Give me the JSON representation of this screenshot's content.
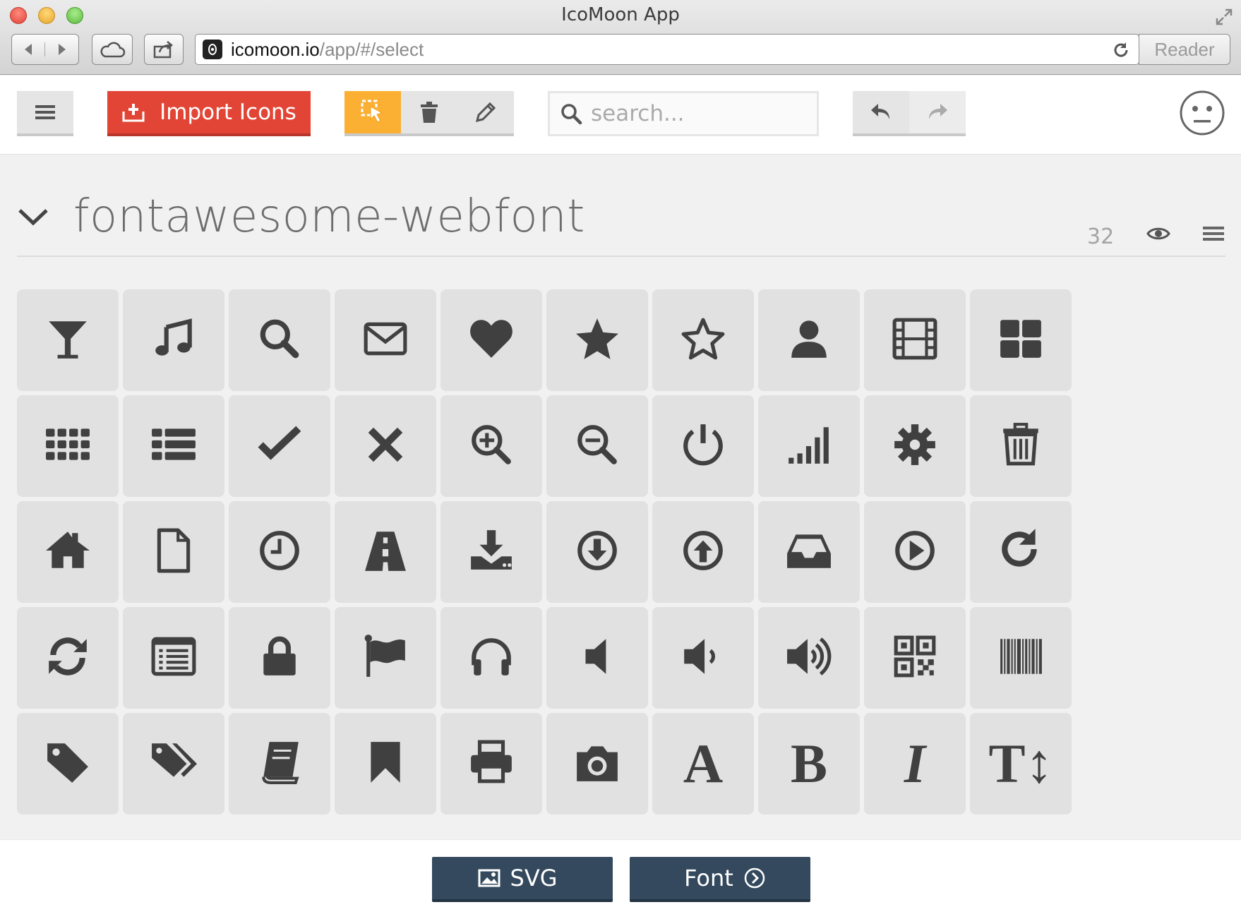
{
  "window": {
    "title": "IcoMoon App"
  },
  "address": {
    "host": "icomoon.io",
    "path": "/app/#/select",
    "reader_label": "Reader"
  },
  "toolbar": {
    "import_label": "Import Icons",
    "search_placeholder": "search..."
  },
  "icon_set": {
    "name": "fontawesome-webfont",
    "count": "32",
    "icons": [
      {
        "name": "glass-icon"
      },
      {
        "name": "music-icon"
      },
      {
        "name": "search-icon"
      },
      {
        "name": "envelope-icon"
      },
      {
        "name": "heart-icon"
      },
      {
        "name": "star-icon"
      },
      {
        "name": "star-empty-icon"
      },
      {
        "name": "user-icon"
      },
      {
        "name": "film-icon"
      },
      {
        "name": "th-large-icon"
      },
      {
        "name": "th-icon"
      },
      {
        "name": "th-list-icon"
      },
      {
        "name": "ok-icon"
      },
      {
        "name": "remove-icon"
      },
      {
        "name": "zoom-in-icon"
      },
      {
        "name": "zoom-out-icon"
      },
      {
        "name": "off-icon"
      },
      {
        "name": "signal-icon"
      },
      {
        "name": "cog-icon"
      },
      {
        "name": "trash-icon"
      },
      {
        "name": "home-icon"
      },
      {
        "name": "file-icon"
      },
      {
        "name": "time-icon"
      },
      {
        "name": "road-icon"
      },
      {
        "name": "download-alt-icon"
      },
      {
        "name": "download-icon"
      },
      {
        "name": "upload-icon"
      },
      {
        "name": "inbox-icon"
      },
      {
        "name": "play-circle-icon"
      },
      {
        "name": "repeat-icon"
      },
      {
        "name": "refresh-icon"
      },
      {
        "name": "list-alt-icon"
      },
      {
        "name": "lock-icon"
      },
      {
        "name": "flag-icon"
      },
      {
        "name": "headphones-icon"
      },
      {
        "name": "volume-off-icon"
      },
      {
        "name": "volume-down-icon"
      },
      {
        "name": "volume-up-icon"
      },
      {
        "name": "qrcode-icon"
      },
      {
        "name": "barcode-icon"
      },
      {
        "name": "tag-icon"
      },
      {
        "name": "tags-icon"
      },
      {
        "name": "book-icon"
      },
      {
        "name": "bookmark-icon"
      },
      {
        "name": "print-icon"
      },
      {
        "name": "camera-icon"
      },
      {
        "name": "font-icon",
        "glyph": "A"
      },
      {
        "name": "bold-icon",
        "glyph": "B"
      },
      {
        "name": "italic-icon",
        "glyph": "I"
      },
      {
        "name": "text-height-icon",
        "glyph": "T↕"
      }
    ]
  },
  "footer": {
    "svg_label": "SVG",
    "font_label": "Font"
  },
  "colors": {
    "import": "#e24535",
    "select_tool": "#fbb034",
    "download_btn": "#34495e",
    "icon": "#404040",
    "tile": "#e1e1e1"
  }
}
